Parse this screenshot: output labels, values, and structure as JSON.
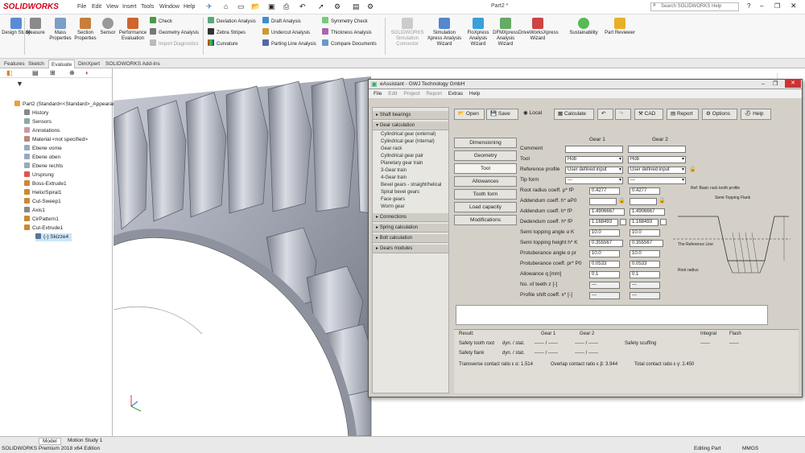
{
  "app": {
    "logo": "SOLIDWORKS",
    "menus": [
      "File",
      "Edit",
      "View",
      "Insert",
      "Tools",
      "Window",
      "Help"
    ],
    "doc_title": "Part2 *",
    "search_placeholder": "Search SOLIDWORKS Help"
  },
  "command_manager": {
    "large_buttons": [
      "Design Study",
      "Measure",
      "Mass Properties",
      "Section Properties",
      "Sensor",
      "Performance Evaluation"
    ],
    "col1": [
      "Check",
      "Geometry Analysis",
      "Import Diagnostics"
    ],
    "col2": [
      "Deviation Analysis",
      "Zebra Stripes",
      "Curvature"
    ],
    "col3": [
      "Draft Analysis",
      "Undercut Analysis",
      "Parting Line Analysis"
    ],
    "col4": [
      "Symmetry Check",
      "Thickness Analysis",
      "Compare Documents"
    ],
    "right_buttons": [
      "SOLIDWORKS Simulation Connector",
      "Simulation Xpress Analysis Wizard",
      "FloXpress Analysis Wizard",
      "DFMXpress Analysis Wizard",
      "DriveWorksXpress Wizard",
      "Sustainability",
      "Part Reviewer"
    ]
  },
  "tabs": [
    "Features",
    "Sketch",
    "Evaluate",
    "DimXpert",
    "SOLIDWORKS Add-Ins"
  ],
  "tree": {
    "root": "Part2 (Standard<<Standard>_Appearan",
    "items": [
      "History",
      "Sensors",
      "Annotations",
      "Material <not specified>",
      "Ebene vorne",
      "Ebene oben",
      "Ebene rechts",
      "Ursprung",
      "Boss-Extrude1",
      "Helix/Spiral1",
      "Cut-Sweep1",
      "Axis1",
      "CirPattern1",
      "Cut-Extrude1",
      "(-) Skizze4"
    ]
  },
  "dialog": {
    "title": "eAssistant - GWJ Technology GmbH",
    "menus": [
      "File",
      "Edit",
      "Project",
      "Report",
      "Extras",
      "Help"
    ],
    "nav": {
      "shaft": "Shaft bearings",
      "gear": "Gear calculation",
      "gear_items": [
        "Cylindrical gear (external)",
        "Cylindrical gear (internal)",
        "Gear rack",
        "Cylindrical gear pair",
        "Planetary gear train",
        "3-Gear train",
        "4-Gear train",
        "Bevel gears - straight/helical",
        "Spiral bevel gears",
        "Face gears",
        "Worm gear"
      ],
      "connections": "Connections",
      "spring": "Spring calculation",
      "bolt": "Bolt calculation",
      "gears_modules": "Gears modules"
    },
    "toolbar": {
      "open": "Open",
      "save": "Save",
      "local": "Local",
      "calculate": "Calculate",
      "cad": "CAD",
      "report": "Report",
      "options": "Options",
      "help": "Help"
    },
    "sections": [
      "Dimensioning",
      "Geometry",
      "Tool",
      "Allowances",
      "Tooth form",
      "Load capacity",
      "Modifications"
    ],
    "columns": [
      "Gear 1",
      "Gear 2"
    ],
    "fields": [
      {
        "label": "Comment",
        "g1": "",
        "g2": ""
      },
      {
        "label": "Tool",
        "g1": "Hob",
        "g2": "Hob"
      },
      {
        "label": "Reference profile",
        "g1": "User defined input",
        "g2": "User defined input"
      },
      {
        "label": "Tip form",
        "g1": "---",
        "g2": "---"
      },
      {
        "label": "Root radius coeff. ρ* fP",
        "g1": "0.4277",
        "g2": "0.4277"
      },
      {
        "label": "Addendum coeff. h* aP0",
        "g1": "",
        "g2": ""
      },
      {
        "label": "Addendum coeff. h* fP",
        "g1": "1.4906667",
        "g2": "1.4906667"
      },
      {
        "label": "Dedendum coeff. h* fP",
        "g1": "1.168493",
        "g2": "1.168493"
      },
      {
        "label": "Semi topping angle α K",
        "g1": "10.0",
        "g2": "10.0"
      },
      {
        "label": "Semi topping height h* K",
        "g1": "0.355567",
        "g2": "0.355567"
      },
      {
        "label": "Protuberance angle α pr",
        "g1": "10.0",
        "g2": "10.0"
      },
      {
        "label": "Protuberance coeff. pr* P0",
        "g1": "0.0533",
        "g2": "0.0533"
      },
      {
        "label": "Allowance q [mm]",
        "g1": "0.1",
        "g2": "0.1"
      },
      {
        "label": "No. of teeth z [-]",
        "g1": "---",
        "g2": "---"
      },
      {
        "label": "Profile shift coeff. x* [-]",
        "g1": "---",
        "g2": "---"
      }
    ],
    "diagram": {
      "title": "Ref: Basic rack tooth profile",
      "tip": "Semi-Topping Flank",
      "ref": "The Reference Line",
      "root": "Root radius"
    },
    "results": {
      "label": "Result:",
      "headers": [
        "Gear 1",
        "Gear 2",
        "Safety scuffing",
        "Integral",
        "Flash"
      ],
      "root": "Safety tooth root",
      "flank": "Safety flank",
      "dyn": "dyn. / stat.",
      "ratio_t": "Transverse contact ratio ε α: 1.514",
      "ratio_o": "Overlap contact ratio ε β: 3.944",
      "ratio_total": "Total contact ratio ε γ: 2.450"
    }
  },
  "status": {
    "left": "SOLIDWORKS Premium 2018 x64 Edition",
    "editing": "Editing Part",
    "units": "MMGS"
  },
  "bottom_tabs": [
    "Model",
    "Motion Study 1"
  ]
}
